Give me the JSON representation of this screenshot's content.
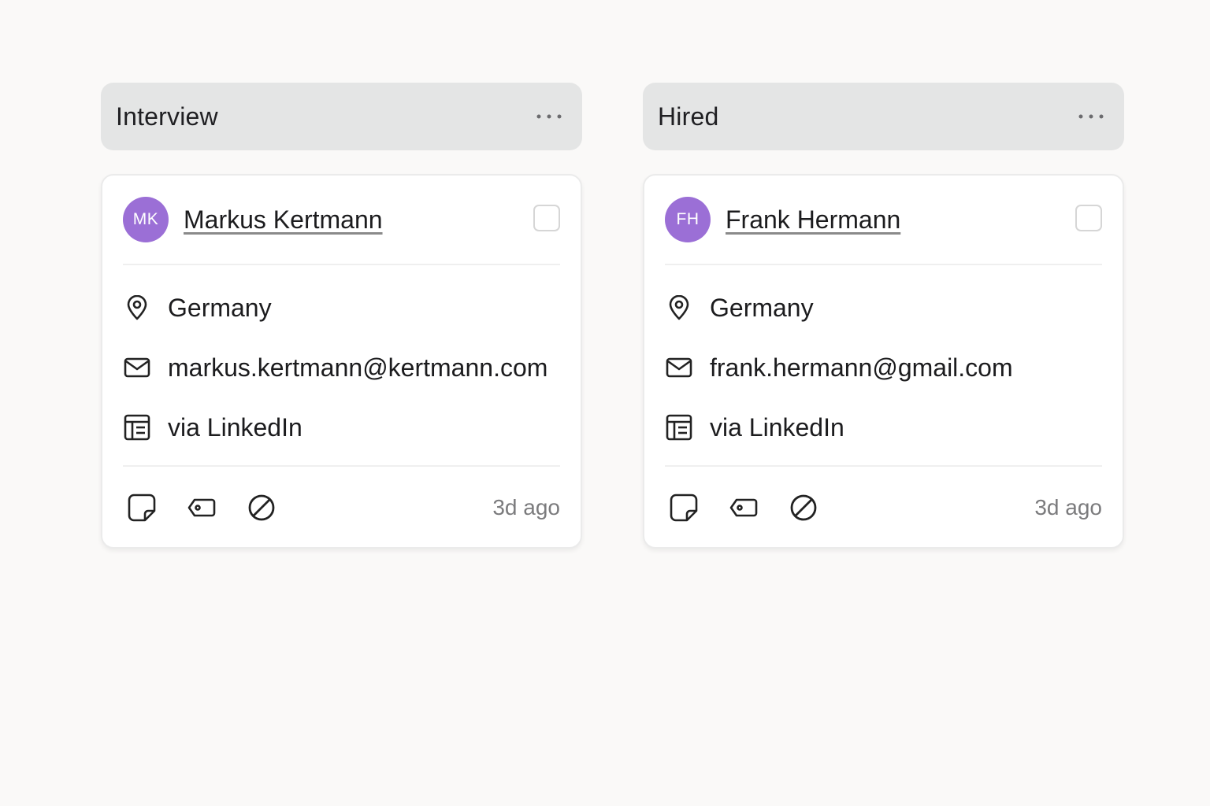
{
  "columns": [
    {
      "title": "Interview",
      "card": {
        "initials": "MK",
        "name": "Markus Kertmann",
        "location": "Germany",
        "email": "markus.kertmann@kertmann.com",
        "source": "via LinkedIn",
        "time": "3d ago"
      }
    },
    {
      "title": "Hired",
      "card": {
        "initials": "FH",
        "name": "Frank Hermann",
        "location": "Germany",
        "email": "frank.hermann@gmail.com",
        "source": "via LinkedIn",
        "time": "3d ago"
      }
    }
  ],
  "colors": {
    "avatar": "#9b6fd6",
    "header_bg": "#e4e5e5",
    "page_bg": "#faf9f8",
    "muted_text": "#7b7b7d"
  },
  "icons": {
    "menu": "more-horizontal-icon",
    "location": "map-pin-icon",
    "email": "mail-icon",
    "source": "source-table-icon",
    "note": "sticky-note-icon",
    "tag": "tag-icon",
    "reject": "ban-icon"
  }
}
